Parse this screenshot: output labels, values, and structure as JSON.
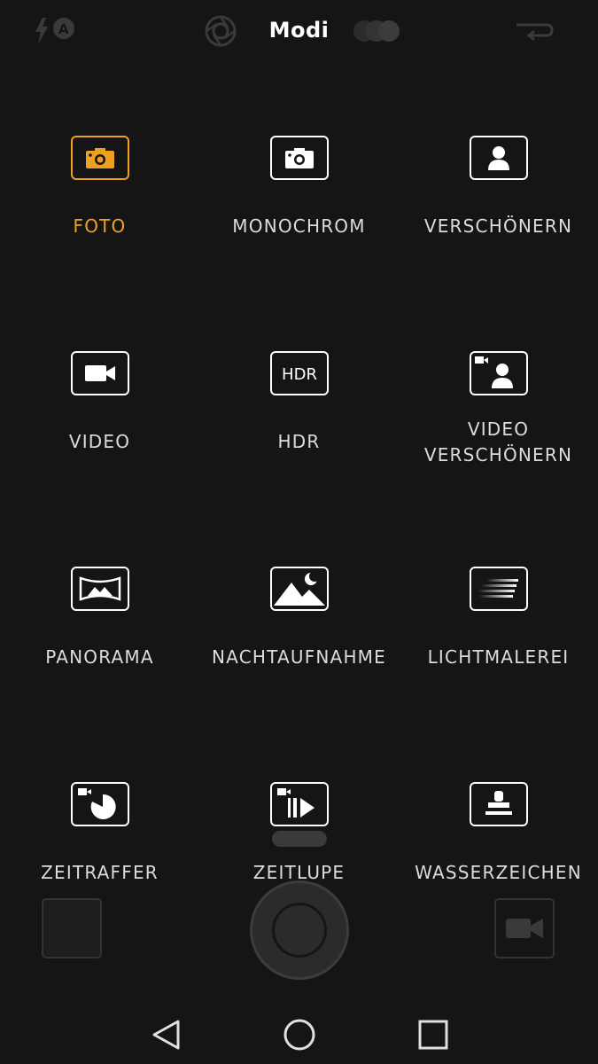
{
  "header": {
    "title": "Modi",
    "icons": [
      "flash-auto-icon",
      "aperture-icon",
      "filter-icon",
      "switch-camera-icon"
    ]
  },
  "modes": [
    {
      "id": "foto",
      "label": "FOTO",
      "icon": "photo-camera-icon",
      "active": true
    },
    {
      "id": "monochrom",
      "label": "MONOCHROM",
      "icon": "monochrome-camera-icon",
      "active": false
    },
    {
      "id": "verschoenern",
      "label": "VERSCHÖNERN",
      "icon": "portrait-icon",
      "active": false
    },
    {
      "id": "video",
      "label": "VIDEO",
      "icon": "video-camera-icon",
      "active": false
    },
    {
      "id": "hdr",
      "label": "HDR",
      "icon": "hdr-icon",
      "active": false
    },
    {
      "id": "video-verschoenern",
      "label": "VIDEO\nVERSCHÖNERN",
      "icon": "video-portrait-icon",
      "active": false
    },
    {
      "id": "panorama",
      "label": "PANORAMA",
      "icon": "panorama-icon",
      "active": false
    },
    {
      "id": "nachtaufnahme",
      "label": "NACHTAUFNAHME",
      "icon": "night-mountain-icon",
      "active": false
    },
    {
      "id": "lichtmalerei",
      "label": "LICHTMALEREI",
      "icon": "light-trails-icon",
      "active": false
    },
    {
      "id": "zeitraffer",
      "label": "ZEITRAFFER",
      "icon": "timelapse-icon",
      "active": false
    },
    {
      "id": "zeitlupe",
      "label": "ZEITLUPE",
      "icon": "slow-motion-icon",
      "active": false
    },
    {
      "id": "wasserzeichen",
      "label": "WASSERZEICHEN",
      "icon": "watermark-stamp-icon",
      "active": false
    }
  ],
  "icon_text": {
    "hdr": "HDR"
  },
  "colors": {
    "accent": "#f0a020",
    "background": "#151515",
    "text": "#dcdcdc"
  }
}
